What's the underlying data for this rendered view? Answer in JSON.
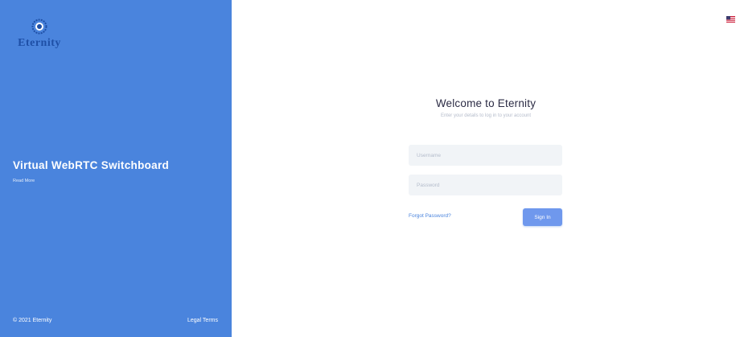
{
  "brand": {
    "name": "Eternity",
    "logo_icon": "eternity-logo-icon"
  },
  "left_panel": {
    "title": "Virtual WebRTC Switchboard",
    "subtitle": "Read More",
    "copyright": "© 2021 Eternity",
    "legal_link": "Legal Terms",
    "background_color": "#4a84dd"
  },
  "language": {
    "icon": "us-flag-icon"
  },
  "login": {
    "heading": "Welcome to Eternity",
    "subheading": "Enter your details to log in to your account",
    "username_placeholder": "Username",
    "password_placeholder": "Password",
    "forgot_label": "Forgot Password?",
    "signin_label": "Sign In",
    "accent_color": "#6f98ed"
  }
}
